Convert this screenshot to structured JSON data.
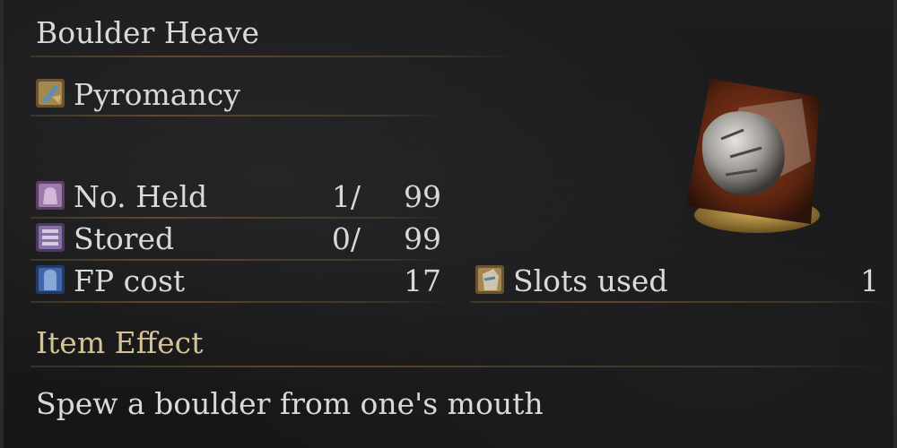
{
  "spell": {
    "name": "Boulder Heave",
    "category": "Pyromancy",
    "image_icon": "boulder-scroll-icon"
  },
  "stats": {
    "held_label": "No. Held",
    "held_value": "1/",
    "held_max": "99",
    "stored_label": "Stored",
    "stored_value": "0/",
    "stored_max": "99",
    "fp_label": "FP cost",
    "fp_value": "17",
    "slots_label": "Slots used",
    "slots_value": "1"
  },
  "effect": {
    "heading": "Item Effect",
    "description": "Spew a boulder from one's mouth"
  },
  "colors": {
    "text": "#d9d9d9",
    "heading_gold": "#d6c395",
    "background": "#1a1a1b"
  }
}
